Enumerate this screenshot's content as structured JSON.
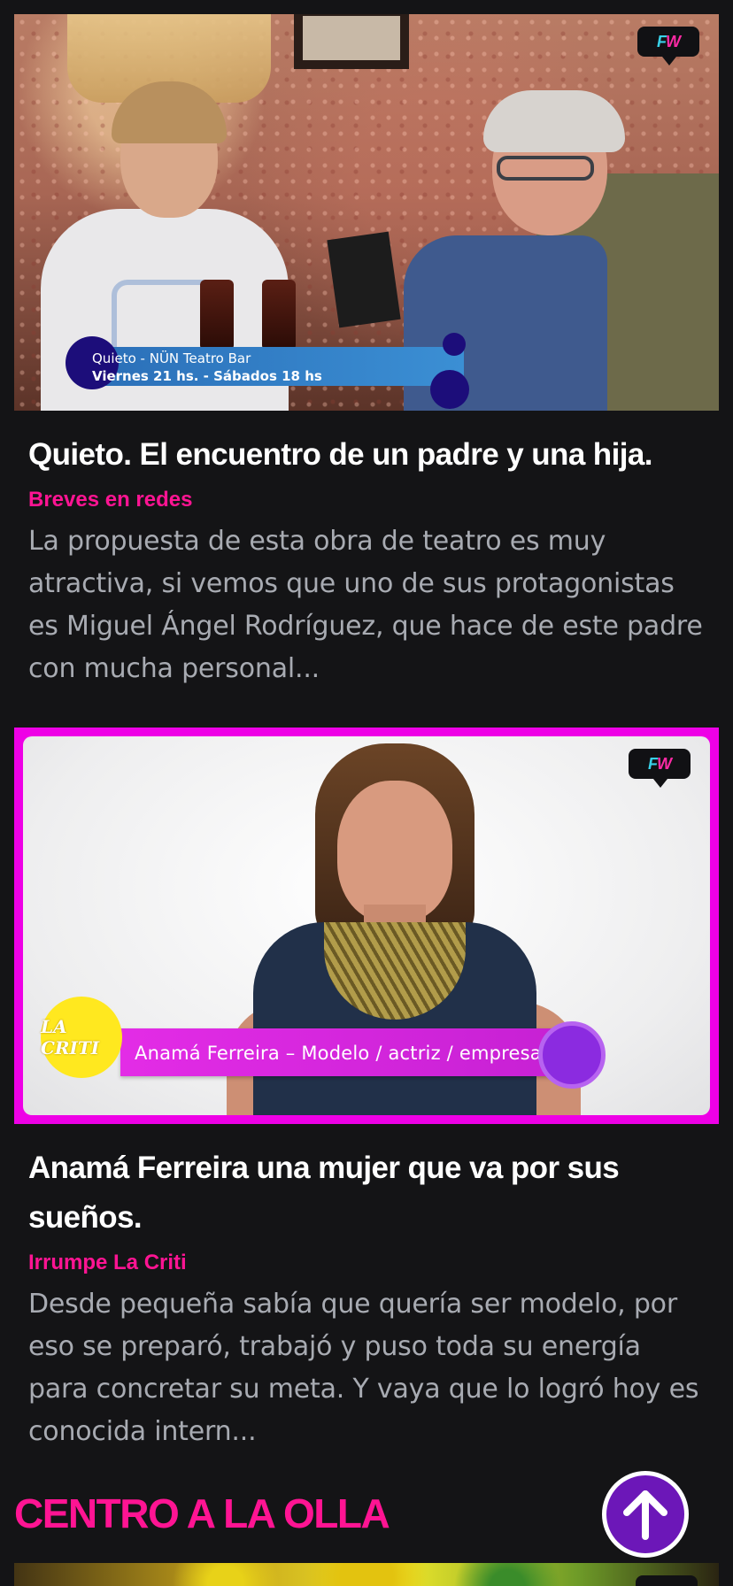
{
  "articles": [
    {
      "title": "Quieto. El encuentro de un padre y una hija.",
      "category": "Breves en redes",
      "excerpt": "La propuesta de esta obra de teatro es muy atractiva, si vemos que uno de sus protagonistas es Miguel Ángel Rodríguez, que hace de este padre con mucha personal...",
      "thumbnail": {
        "badge_f": "F",
        "badge_w": "W",
        "overlay_line1": "Quieto - NÜN Teatro Bar",
        "overlay_line2": "Viernes 21 hs. - Sábados 18 hs"
      }
    },
    {
      "title": "Anamá Ferreira una mujer que va por sus sueños.",
      "category": "Irrumpe La Criti",
      "excerpt": "Desde pequeña sabía que quería ser modelo, por eso se preparó, trabajó y puso toda su energía para concretar su meta. Y vaya que lo logró hoy es conocida intern...",
      "thumbnail": {
        "badge_f": "F",
        "badge_w": "W",
        "overlay_logo": "LA CRITI",
        "overlay_text": "Anamá Ferreira – Modelo / actriz / empresaria"
      }
    }
  ],
  "section": {
    "heading": "CENTRO A LA OLLA"
  },
  "colors": {
    "accent": "#ff1493",
    "background": "#141416",
    "title": "#ffffff",
    "excerpt": "#a8abb2",
    "scroll_button": "#6c17b8",
    "thumb_border": "#ee00e6"
  },
  "icons": {
    "scroll_top": "arrow-up-icon",
    "badge": "fw-logo-icon"
  }
}
